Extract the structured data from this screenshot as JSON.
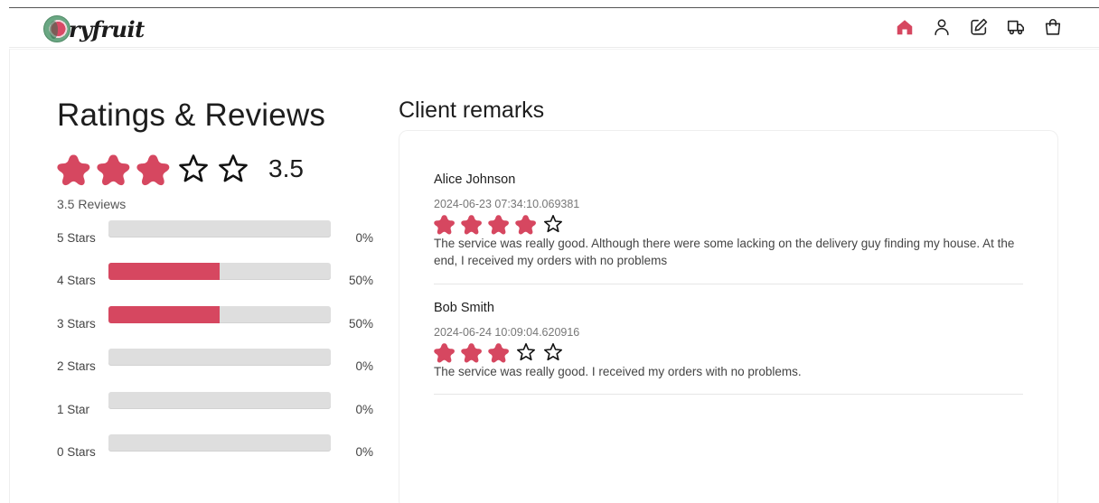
{
  "brand": {
    "logo_text": "ryfruit",
    "logo_letter": "D"
  },
  "nav": {
    "icons": [
      "home-icon",
      "user-icon",
      "edit-icon",
      "delivery-truck-icon",
      "shopping-bag-icon"
    ],
    "active_color": "#d64760"
  },
  "ratings": {
    "title": "Ratings & Reviews",
    "average": 3.5,
    "average_label": "3.5",
    "review_count_label": "3.5 Reviews",
    "accent_color": "#d64760",
    "breakdown": [
      {
        "label": "5 Stars",
        "percent": 0,
        "percent_label": "0%"
      },
      {
        "label": "4 Stars",
        "percent": 50,
        "percent_label": "50%"
      },
      {
        "label": "3 Stars",
        "percent": 50,
        "percent_label": "50%"
      },
      {
        "label": "2 Stars",
        "percent": 0,
        "percent_label": "0%"
      },
      {
        "label": "1 Star",
        "percent": 0,
        "percent_label": "0%"
      },
      {
        "label": "0 Stars",
        "percent": 0,
        "percent_label": "0%"
      }
    ]
  },
  "remarks": {
    "title": "Client remarks",
    "items": [
      {
        "name": "Alice Johnson",
        "date": "2024-06-23 07:34:10.069381",
        "rating": 4,
        "text": "The service was really good. Although there were some lacking on the delivery guy finding my house. At the end, I received my orders with no problems"
      },
      {
        "name": "Bob Smith",
        "date": "2024-06-24 10:09:04.620916",
        "rating": 3,
        "text": "The service was really good. I received my orders with no problems."
      }
    ]
  }
}
